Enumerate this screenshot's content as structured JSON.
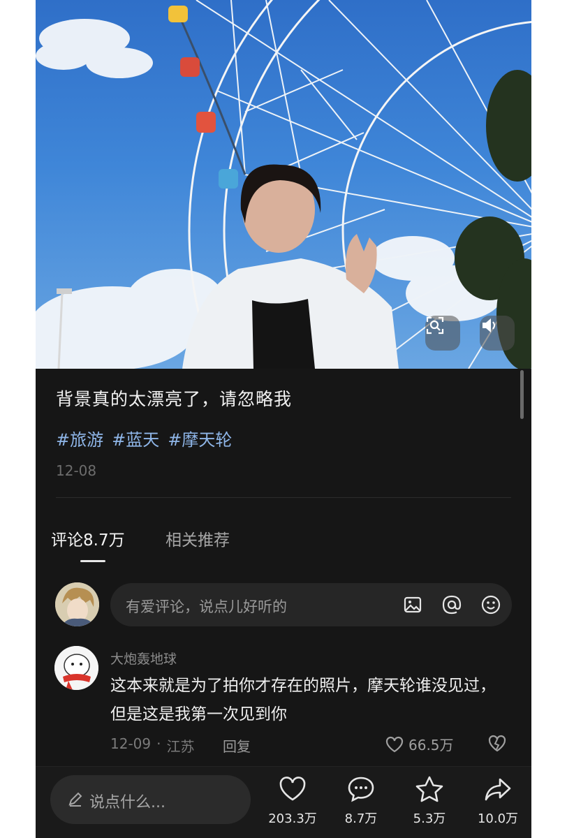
{
  "post": {
    "caption": "背景真的太漂亮了，请忽略我",
    "tags": [
      "#旅游",
      "#蓝天",
      "#摩天轮"
    ],
    "date": "12-08"
  },
  "tabs": {
    "comments": "评论8.7万",
    "related": "相关推荐"
  },
  "comment_input": {
    "placeholder": "有爱评论，说点儿好听的",
    "icons": [
      "image-icon",
      "at-icon",
      "emoji-icon"
    ]
  },
  "comment": {
    "username": "大炮轰地球",
    "text": "这本来就是为了拍你才存在的照片，摩天轮谁没见过，但是这是我第一次见到你",
    "date": "12-09",
    "separator": "·",
    "location": "江苏",
    "reply_label": "回复",
    "likes": "66.5万"
  },
  "bottom_bar": {
    "input_placeholder": "说点什么...",
    "actions": [
      {
        "icon": "heart-icon",
        "count": "203.3万"
      },
      {
        "icon": "comment-icon",
        "count": "8.7万"
      },
      {
        "icon": "star-icon",
        "count": "5.3万"
      },
      {
        "icon": "share-icon",
        "count": "10.0万"
      }
    ]
  },
  "colors": {
    "background": "#161616",
    "tag": "#8fb6e8",
    "text_primary": "#f2f2f2",
    "text_secondary": "#8c8c8c"
  }
}
